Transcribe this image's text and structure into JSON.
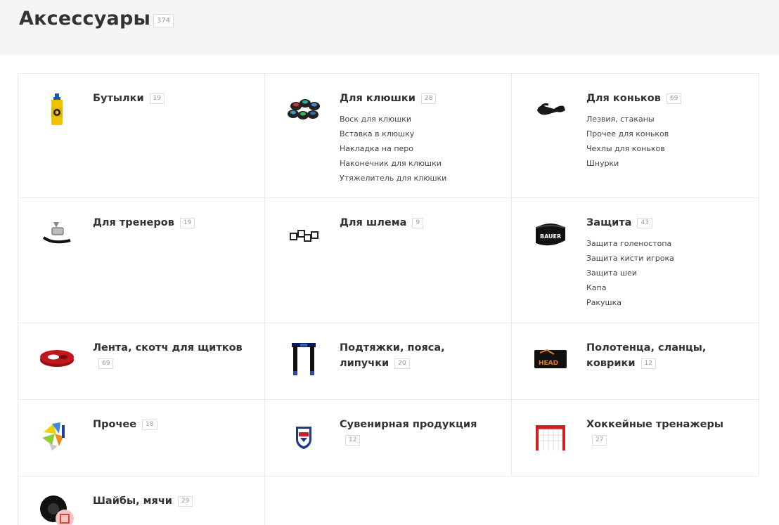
{
  "header": {
    "title": "Аксессуары",
    "count": "374"
  },
  "categories": [
    {
      "title": "Бутылки",
      "count": "19",
      "subs": []
    },
    {
      "title": "Для клюшки",
      "count": "28",
      "subs": [
        "Воск для клюшки",
        "Вставка в клюшку",
        "Накладка на перо",
        "Наконечник для клюшки",
        "Утяжелитель для клюшки"
      ]
    },
    {
      "title": "Для коньков",
      "count": "69",
      "subs": [
        "Лезвия, стаканы",
        "Прочее для коньков",
        "Чехлы для коньков",
        "Шнурки"
      ]
    },
    {
      "title": "Для тренеров",
      "count": "19",
      "subs": []
    },
    {
      "title": "Для шлема",
      "count": "9",
      "subs": []
    },
    {
      "title": "Защита",
      "count": "43",
      "subs": [
        "Защита голеностопа",
        "Защита кисти игрока",
        "Защита шеи",
        "Капа",
        "Ракушка"
      ]
    },
    {
      "title": "Лента, скотч для щитков",
      "count": "69",
      "subs": []
    },
    {
      "title": "Подтяжки, пояса, липучки",
      "count": "20",
      "subs": []
    },
    {
      "title": "Полотенца, сланцы, коврики",
      "count": "12",
      "subs": []
    },
    {
      "title": "Прочее",
      "count": "18",
      "subs": []
    },
    {
      "title": "Сувенирная продукция",
      "count": "12",
      "subs": []
    },
    {
      "title": "Хоккейные тренажеры",
      "count": "27",
      "subs": []
    },
    {
      "title": "Шайбы, мячи",
      "count": "29",
      "subs": []
    }
  ],
  "icons": [
    "bottle-icon",
    "stick-pucks-icon",
    "skate-guard-icon",
    "coach-whistle-icon",
    "helmet-clips-icon",
    "neck-guard-icon",
    "tape-roll-icon",
    "suspenders-icon",
    "towel-mat-icon",
    "misc-accessories-icon",
    "team-logo-icon",
    "hockey-goal-icon",
    "puck-ball-icon"
  ]
}
